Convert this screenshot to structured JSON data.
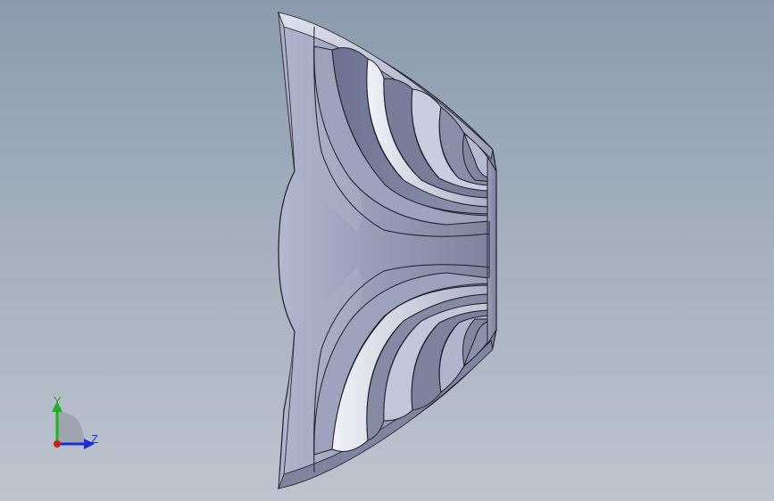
{
  "viewport": {
    "background_top": "#8b9bad",
    "background_bottom": "#bcc4cf"
  },
  "model": {
    "description_icon": "3d-model-part",
    "face_color": "#8e94ad",
    "highlight_color": "#e3e6f2",
    "edge_color": "#1c1d26"
  },
  "triad": {
    "y_label": "Y",
    "z_label": "Z",
    "y_color": "#1fb31f",
    "z_color": "#1b2fd4",
    "x_color": "#d01e1e"
  }
}
